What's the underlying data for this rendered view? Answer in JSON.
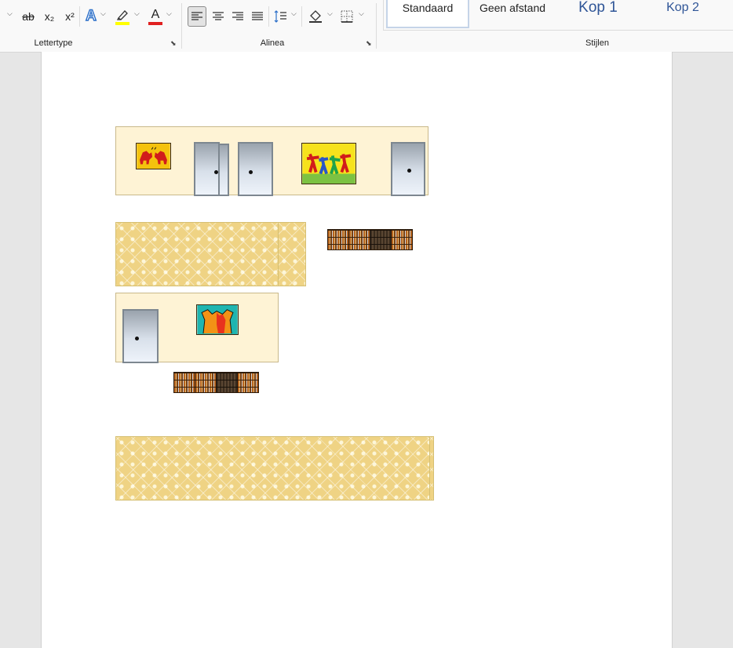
{
  "ribbon": {
    "font_group": {
      "label": "Lettertype",
      "buttons": {
        "strikethrough": "ab",
        "subscript": "x₂",
        "superscript": "x²",
        "text_effects": "A",
        "font_color": "A"
      }
    },
    "paragraph_group": {
      "label": "Alinea"
    },
    "styles_group": {
      "label": "Stijlen",
      "styles": [
        {
          "label": "Standaard",
          "selected": true
        },
        {
          "label": "Geen afstand",
          "selected": false
        },
        {
          "label": "Kop 1",
          "selected": false
        },
        {
          "label": "Kop 2",
          "selected": false
        }
      ]
    },
    "colors": {
      "highlight": "#ffff00",
      "font_color": "#e02020",
      "text_effects": "#2b6fc9",
      "heading_text": "#2f5597"
    }
  },
  "document": {
    "page_color": "#ffffff",
    "wall_color": "#fef3d5"
  }
}
